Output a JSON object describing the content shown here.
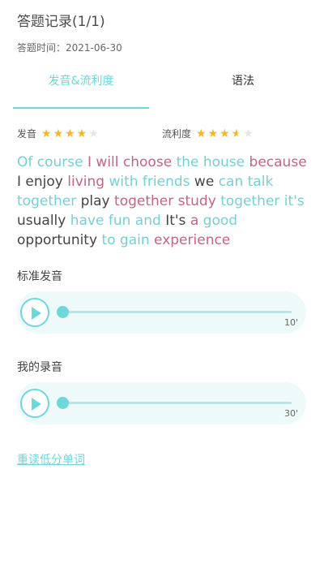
{
  "header": {
    "title": "答题记录(1/1)",
    "date": "答题时间：2021-06-30"
  },
  "tabs": [
    {
      "label": "发音&流利度",
      "active": true
    },
    {
      "label": "语法",
      "active": false
    }
  ],
  "ratings": {
    "pronunciation": {
      "label": "发音",
      "stars": 4,
      "max": 5
    },
    "fluency": {
      "label": "流利度",
      "stars": 3.5,
      "max": 5
    }
  },
  "sentence": [
    {
      "text": "Of course",
      "quality": "good"
    },
    {
      "text": "I will choose",
      "quality": "bad"
    },
    {
      "text": "the house",
      "quality": "good"
    },
    {
      "text": "because",
      "quality": "bad"
    },
    {
      "text": "I enjoy",
      "quality": "ok"
    },
    {
      "text": "living",
      "quality": "bad"
    },
    {
      "text": "with friends",
      "quality": "good"
    },
    {
      "text": "we",
      "quality": "ok"
    },
    {
      "text": "can talk together",
      "quality": "good"
    },
    {
      "text": "play",
      "quality": "ok"
    },
    {
      "text": "together study",
      "quality": "bad"
    },
    {
      "text": "together it's",
      "quality": "good"
    },
    {
      "text": "usually",
      "quality": "ok"
    },
    {
      "text": "have fun and",
      "quality": "good"
    },
    {
      "text": "It's",
      "quality": "ok"
    },
    {
      "text": "a",
      "quality": "bad"
    },
    {
      "text": "good",
      "quality": "good"
    },
    {
      "text": "opportunity",
      "quality": "ok"
    },
    {
      "text": "to gain",
      "quality": "good"
    },
    {
      "text": "experience",
      "quality": "bad"
    }
  ],
  "standard_audio": {
    "label": "标准发音",
    "duration": "10'",
    "progress": 0
  },
  "my_audio": {
    "label": "我的录音",
    "duration": "30'",
    "progress": 0
  },
  "reread_link": "重读低分单词",
  "colors": {
    "accent": "#6fd6d9",
    "bad_word": "#c56487",
    "star": "#f6b81f"
  },
  "icons": {
    "play": "play-icon",
    "star": "star-icon"
  }
}
